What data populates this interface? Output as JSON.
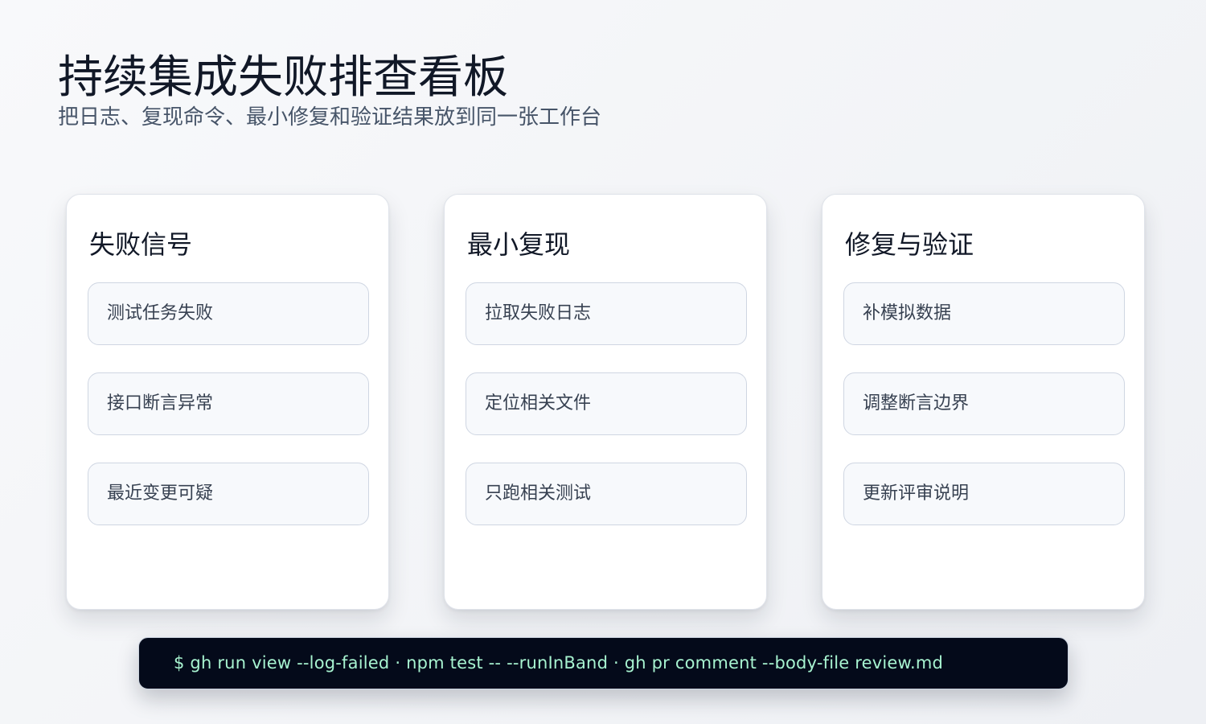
{
  "header": {
    "title": "持续集成失败排查看板",
    "subtitle": "把日志、复现命令、最小修复和验证结果放到同一张工作台"
  },
  "columns": [
    {
      "title": "失败信号",
      "items": [
        "测试任务失败",
        "接口断言异常",
        "最近变更可疑"
      ]
    },
    {
      "title": "最小复现",
      "items": [
        "拉取失败日志",
        "定位相关文件",
        "只跑相关测试"
      ]
    },
    {
      "title": "修复与验证",
      "items": [
        "补模拟数据",
        "调整断言边界",
        "更新评审说明"
      ]
    }
  ],
  "command_bar": {
    "text": "$ gh run view --log-failed  ·  npm test -- --runInBand  ·  gh pr comment --body-file review.md"
  },
  "colors": {
    "background": "#f3f4f7",
    "card": "#ffffff",
    "task_fill": "#f7f9fc",
    "task_border": "#cfd6e2",
    "command_bg": "#040a1a",
    "command_text": "#a7f3d0"
  }
}
